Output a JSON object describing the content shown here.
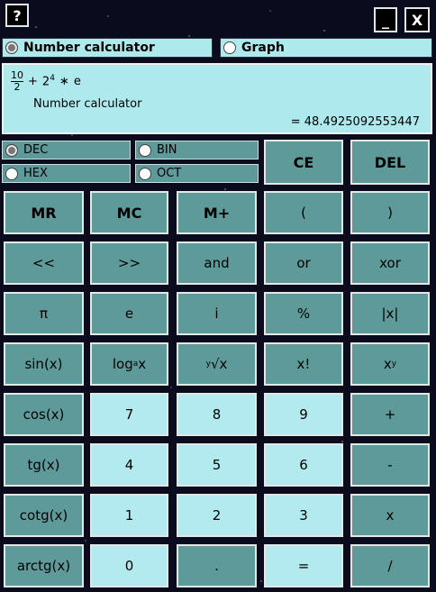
{
  "window": {
    "help_label": "?",
    "minimize_label": "_",
    "close_label": "X"
  },
  "modes": {
    "number_label": "Number calculator",
    "graph_label": "Graph",
    "selected": "number"
  },
  "display": {
    "frac_num": "10",
    "frac_den": "2",
    "op1": "+",
    "base": "2",
    "exp": "4",
    "op2": "∗",
    "const": "e",
    "subtitle": "Number calculator",
    "result": "= 48.4925092553447"
  },
  "bases": {
    "dec": "DEC",
    "bin": "BIN",
    "hex": "HEX",
    "oct": "OCT",
    "selected": "dec"
  },
  "keys": {
    "ce": "CE",
    "del": "DEL",
    "mr": "MR",
    "mc": "MC",
    "mplus": "M+",
    "lparen": "(",
    "rparen": ")",
    "shl": "<<",
    "shr": ">>",
    "and": "and",
    "or": "or",
    "xor": "xor",
    "pi": "π",
    "e": "e",
    "i": "i",
    "percent": "%",
    "abs": "|x|",
    "sin": "sin(x)",
    "log_a": "log",
    "log_sub": "a",
    "log_x": "x",
    "root_y": "y",
    "root_sym": "√x",
    "fact": "x!",
    "pow_x": "x",
    "pow_y": "y",
    "cos": "cos(x)",
    "n7": "7",
    "n8": "8",
    "n9": "9",
    "plus": "+",
    "tg": "tg(x)",
    "n4": "4",
    "n5": "5",
    "n6": "6",
    "minus": "-",
    "cotg": "cotg(x)",
    "n1": "1",
    "n2": "2",
    "n3": "3",
    "times": "x",
    "arctg": "arctg(x)",
    "n0": "0",
    "dot": ".",
    "equals": "=",
    "divide": "/"
  }
}
